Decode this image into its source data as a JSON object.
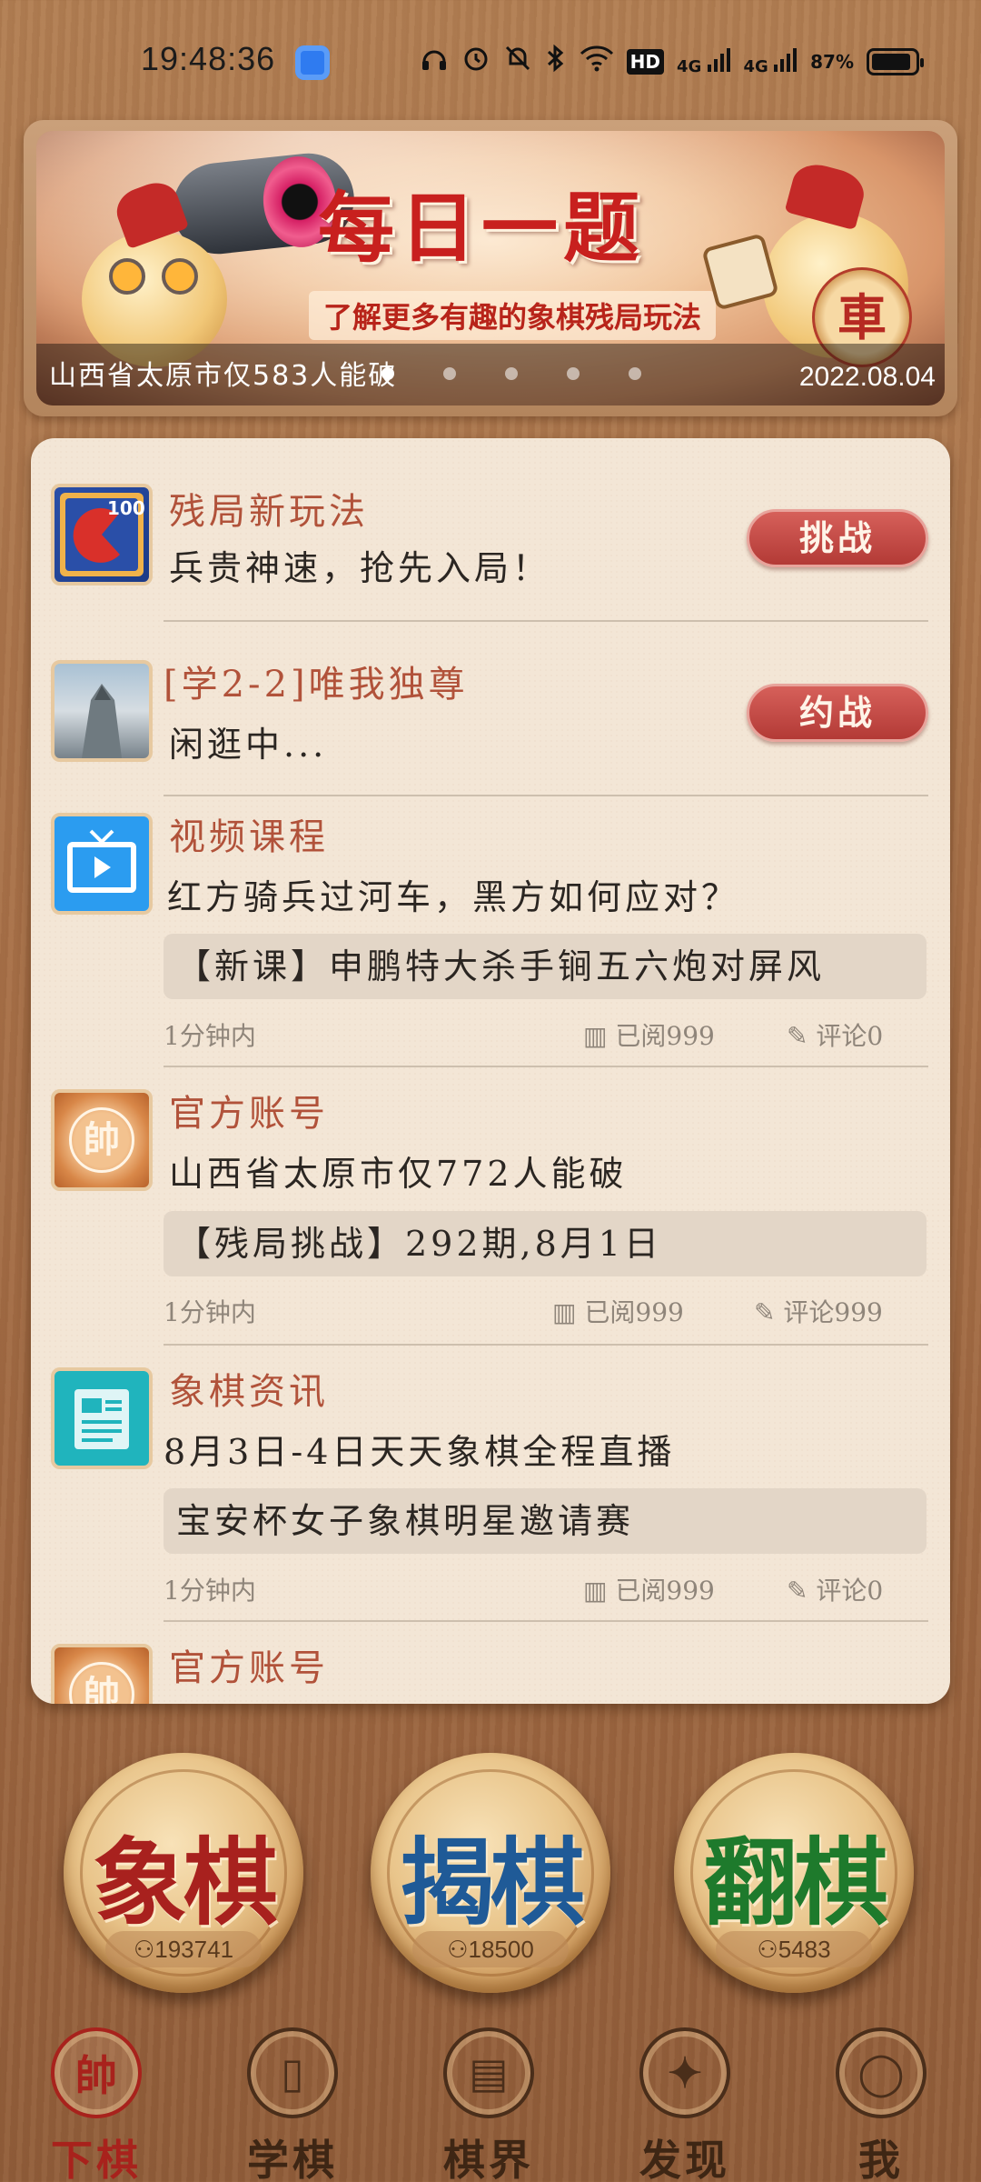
{
  "status_bar": {
    "time": "19:48:36",
    "icons": [
      "headphones-icon",
      "alarm-icon",
      "mute-icon",
      "bluetooth-icon",
      "wifi-icon",
      "hd-icon",
      "signal-4g-icon",
      "signal-4g-icon"
    ],
    "hd_label": "HD",
    "net1": "4G",
    "net2": "4G",
    "battery": "87%"
  },
  "banner": {
    "title": "每日一题",
    "subtitle": "了解更多有趣的象棋残局玩法",
    "piece_char": "車",
    "caption": "山西省太原市仅583人能破",
    "date": "2022.08.04",
    "dot_count": 5,
    "active_dot": 0
  },
  "feed": {
    "item1": {
      "title": "残局新玩法",
      "text": "兵贵神速，抢先入局！",
      "button": "挑战",
      "thumb_badge": "100"
    },
    "item2": {
      "title": "[学2-2]唯我独尊",
      "text": "闲逛中...",
      "button": "约战"
    },
    "item3": {
      "title": "视频课程",
      "text": "红方骑兵过河车，黑方如何应对？",
      "quote": "【新课】申鹏特大杀手锏五六炮对屏风",
      "time": "1分钟内",
      "read": "已阅999",
      "comment": "评论0"
    },
    "item4": {
      "title": "官方账号",
      "text": "山西省太原市仅772人能破",
      "quote": "【残局挑战】292期,8月1日",
      "time": "1分钟内",
      "read": "已阅999",
      "comment": "评论999",
      "thumb_char": "帥"
    },
    "item5": {
      "title": "象棋资讯",
      "text": "8月3日-4日天天象棋全程直播",
      "quote": "宝安杯女子象棋明星邀请赛",
      "time": "1分钟内",
      "read": "已阅999",
      "comment": "评论0"
    },
    "item6": {
      "title": "官方账号",
      "thumb_char": "帥"
    }
  },
  "games": [
    {
      "label": "象棋",
      "count": "193741",
      "color": "#a8211e"
    },
    {
      "label": "揭棋",
      "count": "18500",
      "color": "#1f5a97"
    },
    {
      "label": "翻棋",
      "count": "5483",
      "color": "#1e7a2c"
    }
  ],
  "nav": [
    {
      "label": "下棋",
      "icon_char": "帥",
      "active": true
    },
    {
      "label": "学棋",
      "icon_char": "▯"
    },
    {
      "label": "棋界",
      "icon_char": "▤"
    },
    {
      "label": "发现",
      "icon_char": "✦"
    },
    {
      "label": "我",
      "icon_char": "◯"
    }
  ],
  "colors": {
    "accent_red": "#a8221c",
    "title_brown": "#b1523a",
    "card_bg": "#f3e6d6"
  }
}
